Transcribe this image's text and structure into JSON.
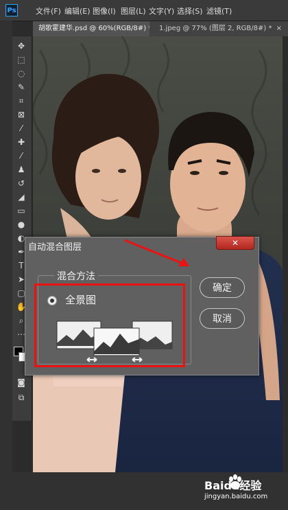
{
  "menubar": {
    "logo": "Ps",
    "items": [
      "文件(F)",
      "编辑(E)",
      "图像(I)",
      "图层(L)",
      "文字(Y)",
      "选择(S)",
      "滤镜(T)"
    ]
  },
  "tabs": [
    {
      "label": "胡歌霍建华.psd @ 60%(RGB/8#) *",
      "close": "×"
    },
    {
      "label": "1.jpeg @ 77% (图层 2, RGB/8#) *",
      "close": "×"
    }
  ],
  "dialog": {
    "title": "自动混合图层",
    "close_symbol": "✕",
    "group_title": "混合方法",
    "option_label": "全景图",
    "option_selected": true,
    "ok_label": "确定",
    "cancel_label": "取消"
  },
  "watermark": {
    "brand": "Baidu经验",
    "url": "jingyan.baidu.com"
  },
  "colors": {
    "accent_red": "#e11111",
    "ps_blue": "#31a8ff"
  }
}
